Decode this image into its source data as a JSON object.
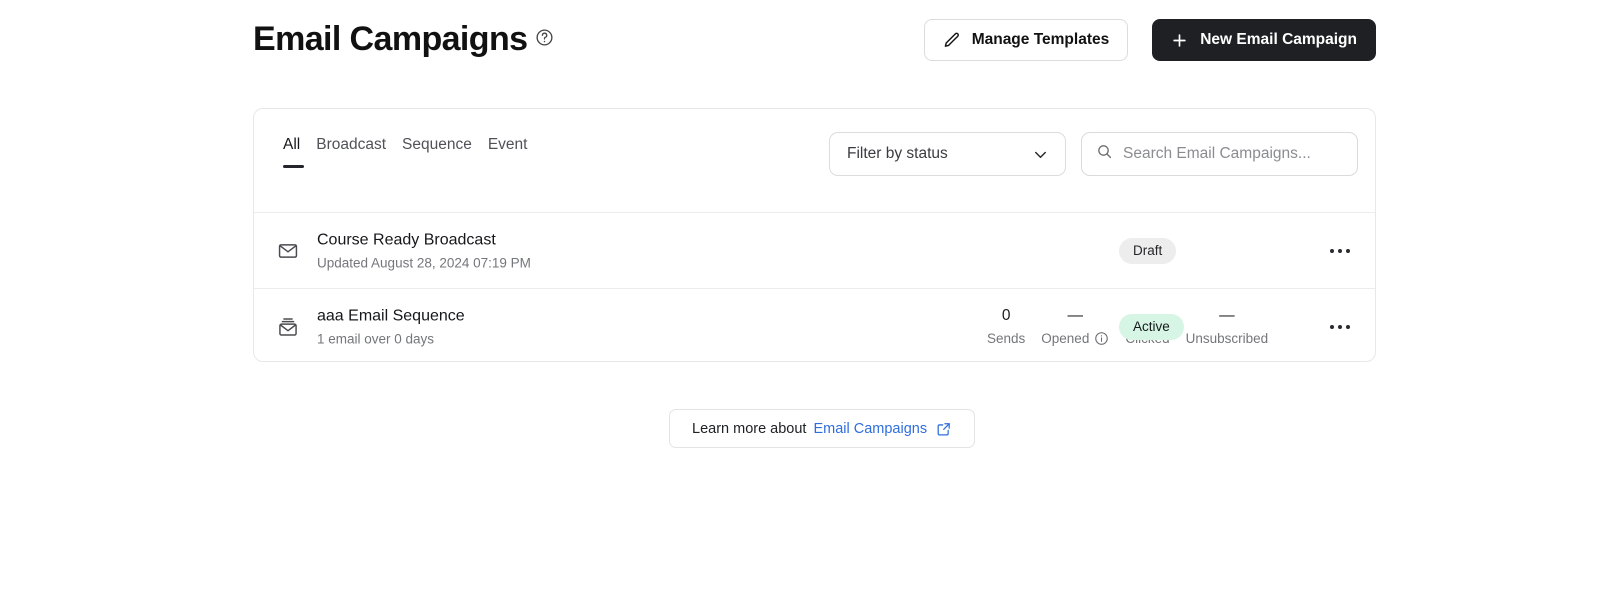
{
  "header": {
    "title": "Email Campaigns",
    "help_icon": "help-circle-icon",
    "manage_templates_label": "Manage Templates",
    "manage_templates_icon": "pencil-icon",
    "new_campaign_label": "New Email Campaign",
    "new_campaign_icon": "plus-icon"
  },
  "toolbar": {
    "tabs": [
      {
        "label": "All",
        "active": true
      },
      {
        "label": "Broadcast",
        "active": false
      },
      {
        "label": "Sequence",
        "active": false
      },
      {
        "label": "Event",
        "active": false
      }
    ],
    "filter": {
      "label": "Filter by status",
      "icon": "chevron-down-icon"
    },
    "search": {
      "placeholder": "Search Email Campaigns...",
      "value": "",
      "icon": "search-icon"
    }
  },
  "rows": [
    {
      "icon": "envelope-icon",
      "title": "Course Ready Broadcast",
      "subtitle": "Updated August 28, 2024 07:19 PM",
      "status": "Draft",
      "status_variant": "draft",
      "has_stats": false,
      "menu_icon": "ellipsis-icon"
    },
    {
      "icon": "email-sequence-icon",
      "title": "aaa Email Sequence",
      "subtitle": "1 email over 0 days",
      "status": "Active",
      "status_variant": "active",
      "has_stats": true,
      "stats": [
        {
          "value": "0",
          "label": "Sends",
          "info": false
        },
        {
          "value": "—",
          "label": "Opened",
          "info": true,
          "info_icon": "info-circle-icon"
        },
        {
          "value": "—",
          "label": "Clicked",
          "info": false
        },
        {
          "value": "—",
          "label": "Unsubscribed",
          "info": false
        }
      ],
      "menu_icon": "ellipsis-icon"
    }
  ],
  "footer": {
    "learn_more_text": "Learn more about",
    "learn_more_link": "Email Campaigns",
    "external_icon": "external-link-icon"
  },
  "colors": {
    "primary_button_bg": "#1f2023",
    "link": "#2f6ede",
    "badge_draft_bg": "#ededee",
    "badge_active_bg": "#d6f5e4",
    "border": "#e8e8e8",
    "muted_text": "#75767b"
  }
}
